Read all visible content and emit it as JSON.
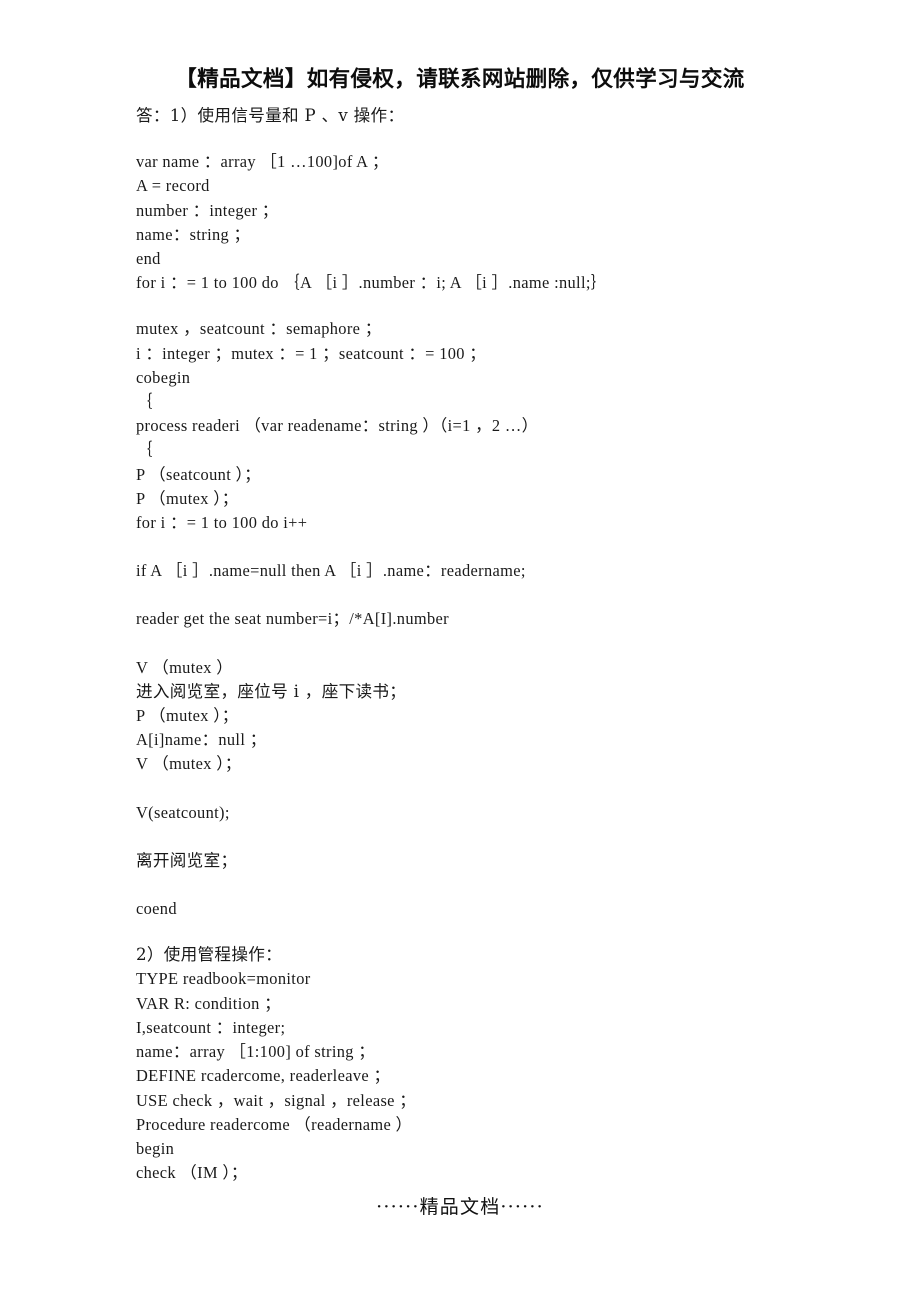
{
  "document": {
    "header_notice": "【精品文档】如有侵权，请联系网站删除，仅供学习与交流",
    "footer_notice": "······精品文档······",
    "page_background": "#ffffff",
    "text_color": "#1a1a1a"
  },
  "content": {
    "intro_line": "答：1）使用信号量和 P 、v 操作：",
    "section1_title": "答：1）使用信号量和 P 、v 操作：",
    "section2_title": "2）使用管程操作：",
    "blocks": [
      {
        "id": "declarations",
        "lines": [
          "var name ：array ［1 …100]of A ；",
          "A = record",
          "number ：integer ；",
          "name：string ；",
          "end",
          "for i ：= 1 to 100 do ｛A ［i ］.number ：i; A ［i ］.name :null;｝"
        ]
      },
      {
        "id": "semaphores",
        "lines": [
          "mutex ，seatcount ：semaphore ；",
          "i ：integer ；mutex ：= 1 ；seatcount ：= 100 ；",
          "cobegin",
          "｛",
          "process readeri （var readename：string ）（i=1 ，2 …）",
          "｛",
          "P （seatcount ）；",
          "P （mutex ）；",
          "for i ：= 1 to 100 do i++"
        ]
      },
      {
        "id": "assign-name",
        "lines": [
          "if A ［i ］.name=null then A ［i ］.name：readername;"
        ]
      },
      {
        "id": "seat-comment",
        "lines": [
          "reader get the seat number=i；/*A[I].number"
        ]
      },
      {
        "id": "enter-room",
        "lines": [
          "V （mutex ）",
          "进入阅览室，座位号 i ，座下读书；",
          "P （mutex ）；",
          "A[i]name：null ；",
          "V （mutex ）；"
        ]
      },
      {
        "id": "release-seat",
        "lines": [
          "V(seatcount);"
        ]
      },
      {
        "id": "leave-room",
        "lines": [
          "离开阅览室；"
        ]
      },
      {
        "id": "coend",
        "lines": [
          "coend"
        ]
      },
      {
        "id": "monitor",
        "lines": [
          "2）使用管程操作：",
          "TYPE readbook=monitor",
          "VAR R: condition ；",
          "I,seatcount ：integer;",
          "name：array ［1:100] of string ；",
          "DEFINE rcadercome, readerleave ；",
          "USE check ，wait ，signal ，release ；",
          "Procedure readercome （readername ）",
          "begin",
          "check （IM ）；"
        ]
      }
    ]
  }
}
